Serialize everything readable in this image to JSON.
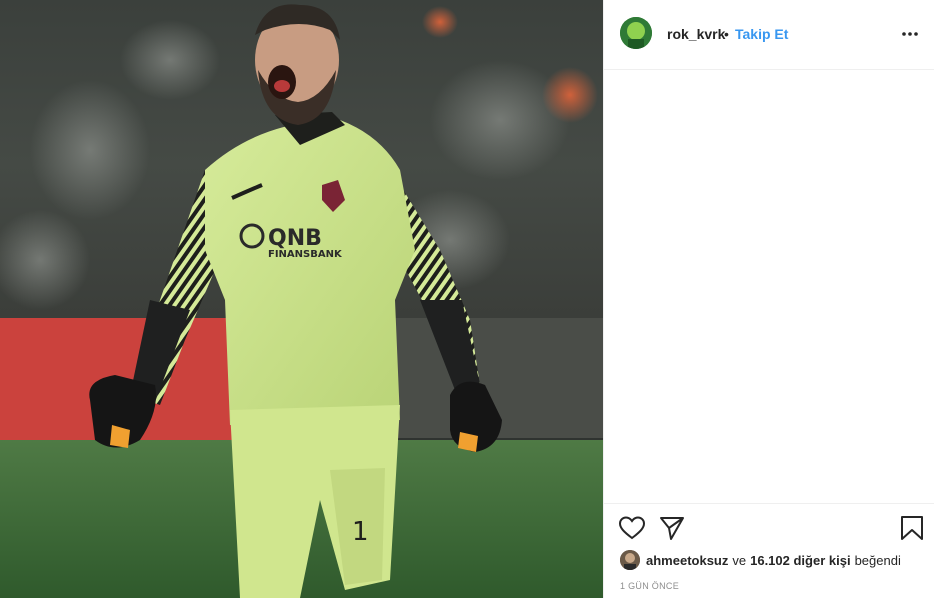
{
  "post": {
    "author": {
      "username": "rok_kvrk",
      "separator": "•",
      "follow_label": "Takip Et"
    },
    "photo": {
      "sponsor_text": "QNB",
      "sponsor_subtext": "FINANSBANK",
      "shirt_number": "1"
    },
    "actions": {
      "like_icon": "heart-icon",
      "share_icon": "paper-plane-icon",
      "save_icon": "bookmark-icon",
      "more_icon": "more-dots-icon"
    },
    "likes": {
      "liker_username": "ahmeetoksuz",
      "connector": "ve",
      "others_count": "16.102 diğer kişi",
      "suffix": "beğendi"
    },
    "timestamp": "1 GÜN ÖNCE"
  },
  "colors": {
    "link_blue": "#3897f0",
    "jersey": "#c8e08a",
    "pitch": "#3d6b35"
  }
}
